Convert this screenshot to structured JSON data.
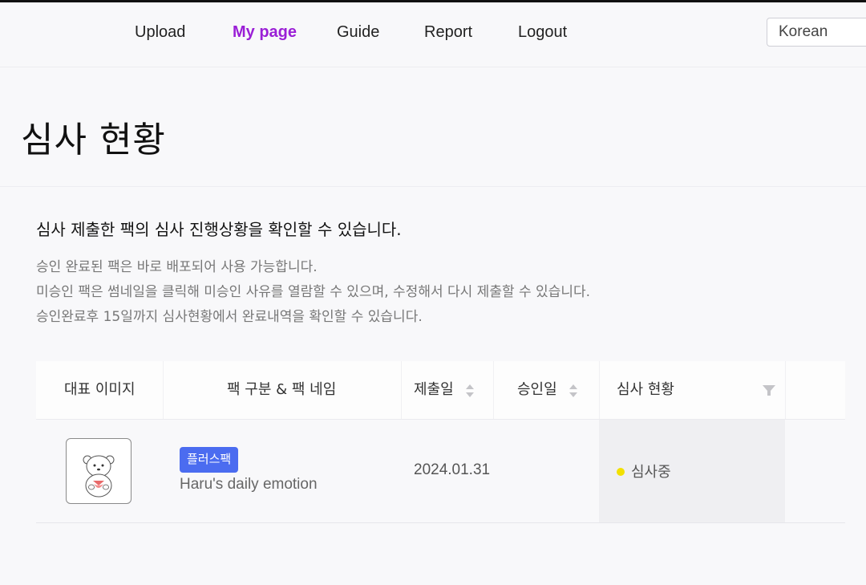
{
  "nav": {
    "items": [
      {
        "label": "Upload"
      },
      {
        "label": "My page",
        "active": true
      },
      {
        "label": "Guide"
      },
      {
        "label": "Report"
      },
      {
        "label": "Logout"
      }
    ],
    "language": "Korean",
    "active_color": "#9a1fd6"
  },
  "page": {
    "title": "심사 현황",
    "description_main": "심사 제출한 팩의 심사 진행상황을 확인할 수 있습니다.",
    "description_lines": [
      "승인 완료된 팩은 바로 배포되어 사용 가능합니다.",
      "미승인 팩은 썸네일을 클릭해 미승인 사유를 열람할 수 있으며, 수정해서 다시 제출할 수 있습니다.",
      "승인완료후 15일까지 심사현황에서 완료내역을 확인할 수 있습니다."
    ]
  },
  "table": {
    "headers": {
      "image": "대표 이미지",
      "pack": "팩 구분 & 팩 네임",
      "submitted": "제출일",
      "approved": "승인일",
      "status": "심사 현황"
    },
    "header_icons": {
      "submitted_sort": "sort-updown-icon",
      "approved_sort": "sort-updown-icon",
      "status_filter": "filter-funnel-icon"
    },
    "rows": [
      {
        "thumbnail_icon": "bear-character-thumbnail",
        "pack_type": "플러스팩",
        "pack_type_color": "#4b6cf0",
        "pack_name": "Haru's daily emotion",
        "submitted": "2024.01.31",
        "approved": "",
        "status": "심사중",
        "status_color": "#f2e000"
      }
    ]
  }
}
